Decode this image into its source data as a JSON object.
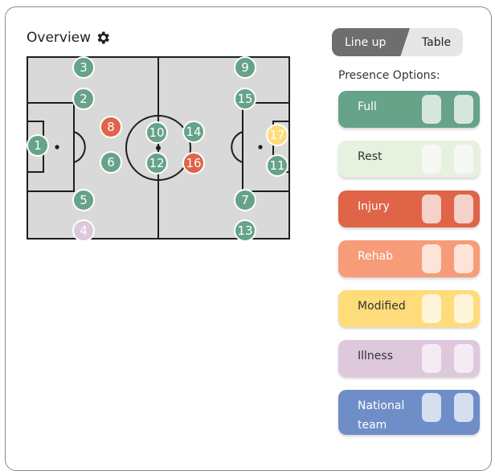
{
  "header": {
    "title": "Overview",
    "settings_icon": "gear-icon"
  },
  "view_toggle": {
    "lineup_label": "Line up",
    "table_label": "Table",
    "selected": "Line up"
  },
  "presence": {
    "label": "Presence Options:",
    "options": [
      {
        "label": "Full",
        "color": "#66a389",
        "text_color": "#ffffff",
        "slot_color": "#d6e6df"
      },
      {
        "label": "Rest",
        "color": "#e6f1df",
        "text_color": "#333333",
        "slot_color": "#f5f9f2"
      },
      {
        "label": "Injury",
        "color": "#df6448",
        "text_color": "#ffffff",
        "slot_color": "#f4d1c9"
      },
      {
        "label": "Rehab",
        "color": "#f79c78",
        "text_color": "#ffffff",
        "slot_color": "#fde3d8"
      },
      {
        "label": "Modified",
        "color": "#fedc7a",
        "text_color": "#333333",
        "slot_color": "#fff5d9"
      },
      {
        "label": "Illness",
        "color": "#dec8dc",
        "text_color": "#333333",
        "slot_color": "#f4ecf3"
      },
      {
        "label": "National team",
        "color": "#6f8ec8",
        "text_color": "#ffffff",
        "slot_color": "#d5dff0"
      }
    ]
  },
  "players": [
    {
      "number": "3",
      "status": "Full"
    },
    {
      "number": "2",
      "status": "Full"
    },
    {
      "number": "1",
      "status": "Full"
    },
    {
      "number": "8",
      "status": "Injury"
    },
    {
      "number": "6",
      "status": "Full"
    },
    {
      "number": "5",
      "status": "Full"
    },
    {
      "number": "4",
      "status": "Illness"
    },
    {
      "number": "10",
      "status": "Full"
    },
    {
      "number": "12",
      "status": "Full"
    },
    {
      "number": "14",
      "status": "Full"
    },
    {
      "number": "16",
      "status": "Injury"
    },
    {
      "number": "9",
      "status": "Full"
    },
    {
      "number": "15",
      "status": "Full"
    },
    {
      "number": "17",
      "status": "Modified"
    },
    {
      "number": "11",
      "status": "Full"
    },
    {
      "number": "7",
      "status": "Full"
    },
    {
      "number": "13",
      "status": "Full"
    }
  ],
  "colors": {
    "pitch_fill": "#d9d9d9",
    "pitch_lines": "#1e1e1e",
    "full": "#66a389",
    "injury": "#df6448",
    "modified": "#fedc7a",
    "illness": "#dec8dc"
  }
}
